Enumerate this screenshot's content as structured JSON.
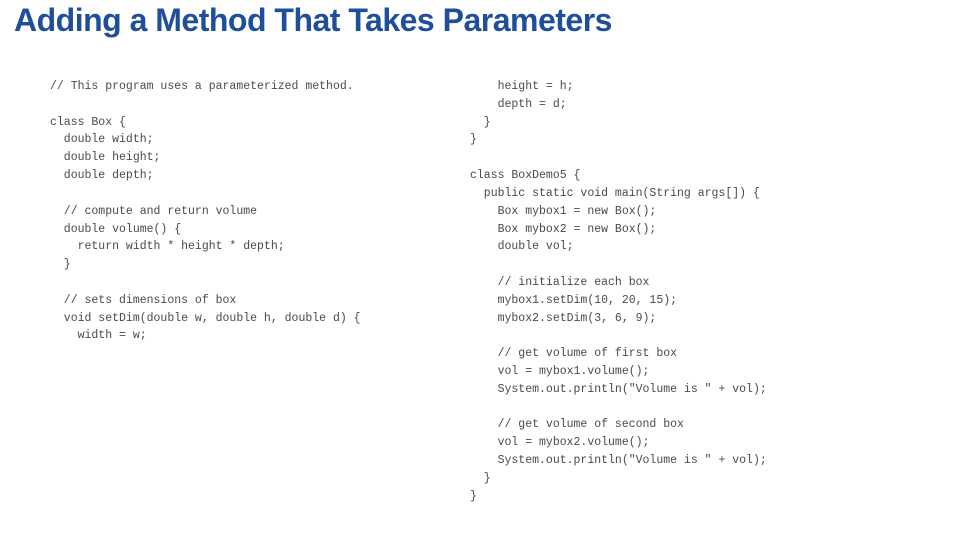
{
  "title": "Adding a Method That Takes Parameters",
  "code": {
    "left": "// This program uses a parameterized method.\n\nclass Box {\n  double width;\n  double height;\n  double depth;\n\n  // compute and return volume\n  double volume() {\n    return width * height * depth;\n  }\n\n  // sets dimensions of box\n  void setDim(double w, double h, double d) {\n    width = w;",
    "right": "    height = h;\n    depth = d;\n  }\n}\n\nclass BoxDemo5 {\n  public static void main(String args[]) {\n    Box mybox1 = new Box();\n    Box mybox2 = new Box();\n    double vol;\n\n    // initialize each box\n    mybox1.setDim(10, 20, 15);\n    mybox2.setDim(3, 6, 9);\n\n    // get volume of first box\n    vol = mybox1.volume();\n    System.out.println(\"Volume is \" + vol);\n\n    // get volume of second box\n    vol = mybox2.volume();\n    System.out.println(\"Volume is \" + vol);\n  }\n}"
  }
}
